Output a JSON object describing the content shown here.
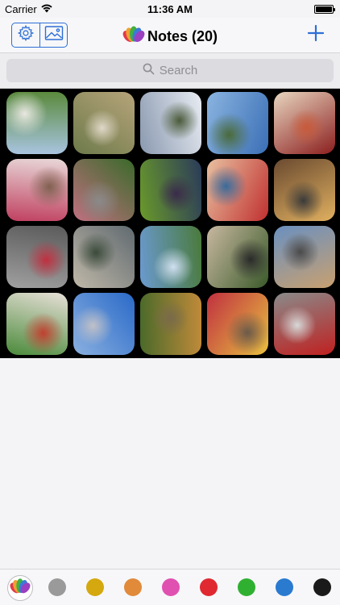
{
  "status_bar": {
    "carrier": "Carrier",
    "time": "11:36 AM",
    "battery_level": 1.0
  },
  "nav": {
    "settings_icon": "gear-icon",
    "gallery_icon": "image-icon",
    "title": "Notes (20)",
    "add_icon": "plus-icon",
    "accent_color": "#2d6fd6"
  },
  "search": {
    "placeholder": "Search"
  },
  "photos": [
    {
      "subject": "birch trees in park",
      "colors": [
        "#5a8a3c",
        "#a8c4e0",
        "#e8e8e0"
      ]
    },
    {
      "subject": "child running on path",
      "colors": [
        "#b6a47a",
        "#6d7a4a",
        "#e0d8c8"
      ]
    },
    {
      "subject": "snowy park",
      "colors": [
        "#e8ecf2",
        "#8a99b0",
        "#4a5a3a"
      ]
    },
    {
      "subject": "Mount Fuji",
      "colors": [
        "#3b6fb6",
        "#8ab4e0",
        "#4a6a3a"
      ]
    },
    {
      "subject": "sushi platter",
      "colors": [
        "#8b1e1e",
        "#e8d6c0",
        "#c85a3a"
      ]
    },
    {
      "subject": "cake with berries",
      "colors": [
        "#e8d8d8",
        "#c04060",
        "#806050"
      ]
    },
    {
      "subject": "garden house",
      "colors": [
        "#3a6a2a",
        "#c07080",
        "#8a8a8a"
      ]
    },
    {
      "subject": "grapes on vine",
      "colors": [
        "#2a3a5a",
        "#6a9a2a",
        "#3a2a4a"
      ]
    },
    {
      "subject": "girl in red hat",
      "colors": [
        "#c03030",
        "#e8c0a0",
        "#3a6a9a"
      ]
    },
    {
      "subject": "child in sun",
      "colors": [
        "#e0b060",
        "#6a4a30",
        "#3a3a3a"
      ]
    },
    {
      "subject": "family walking",
      "colors": [
        "#5a5a5a",
        "#a0a0a0",
        "#c03040"
      ]
    },
    {
      "subject": "tree near building",
      "colors": [
        "#606a70",
        "#c0b8a8",
        "#3a4a3a"
      ]
    },
    {
      "subject": "field and hills",
      "colors": [
        "#4a7a3a",
        "#6a9ad0",
        "#d0e0f0"
      ]
    },
    {
      "subject": "child in hammock",
      "colors": [
        "#3a5a2a",
        "#c8b8a0",
        "#2a2a2a"
      ]
    },
    {
      "subject": "old town street",
      "colors": [
        "#c8a070",
        "#6a90c0",
        "#4a4a4a"
      ]
    },
    {
      "subject": "salad plate",
      "colors": [
        "#e8e0d8",
        "#4a8a3a",
        "#c04030"
      ]
    },
    {
      "subject": "city skyline",
      "colors": [
        "#2a6ac8",
        "#8ab0e0",
        "#c0c0c8"
      ]
    },
    {
      "subject": "autumn path",
      "colors": [
        "#c08a3a",
        "#4a6a2a",
        "#7a6a4a"
      ]
    },
    {
      "subject": "child at window",
      "colors": [
        "#e8c040",
        "#c03040",
        "#6a5a4a"
      ]
    },
    {
      "subject": "child in red coat",
      "colors": [
        "#c02020",
        "#8a8a8a",
        "#d8d8d8"
      ]
    }
  ],
  "color_filters": [
    {
      "name": "all-notes-icon",
      "color": "multicolor"
    },
    {
      "name": "gray",
      "color": "#9a9a9a"
    },
    {
      "name": "yellow",
      "color": "#d4a80e"
    },
    {
      "name": "orange",
      "color": "#e08a3a"
    },
    {
      "name": "pink",
      "color": "#e050b0"
    },
    {
      "name": "red",
      "color": "#e02830"
    },
    {
      "name": "green",
      "color": "#30b030"
    },
    {
      "name": "blue",
      "color": "#2a7ad0"
    },
    {
      "name": "black",
      "color": "#1a1a1a"
    }
  ]
}
